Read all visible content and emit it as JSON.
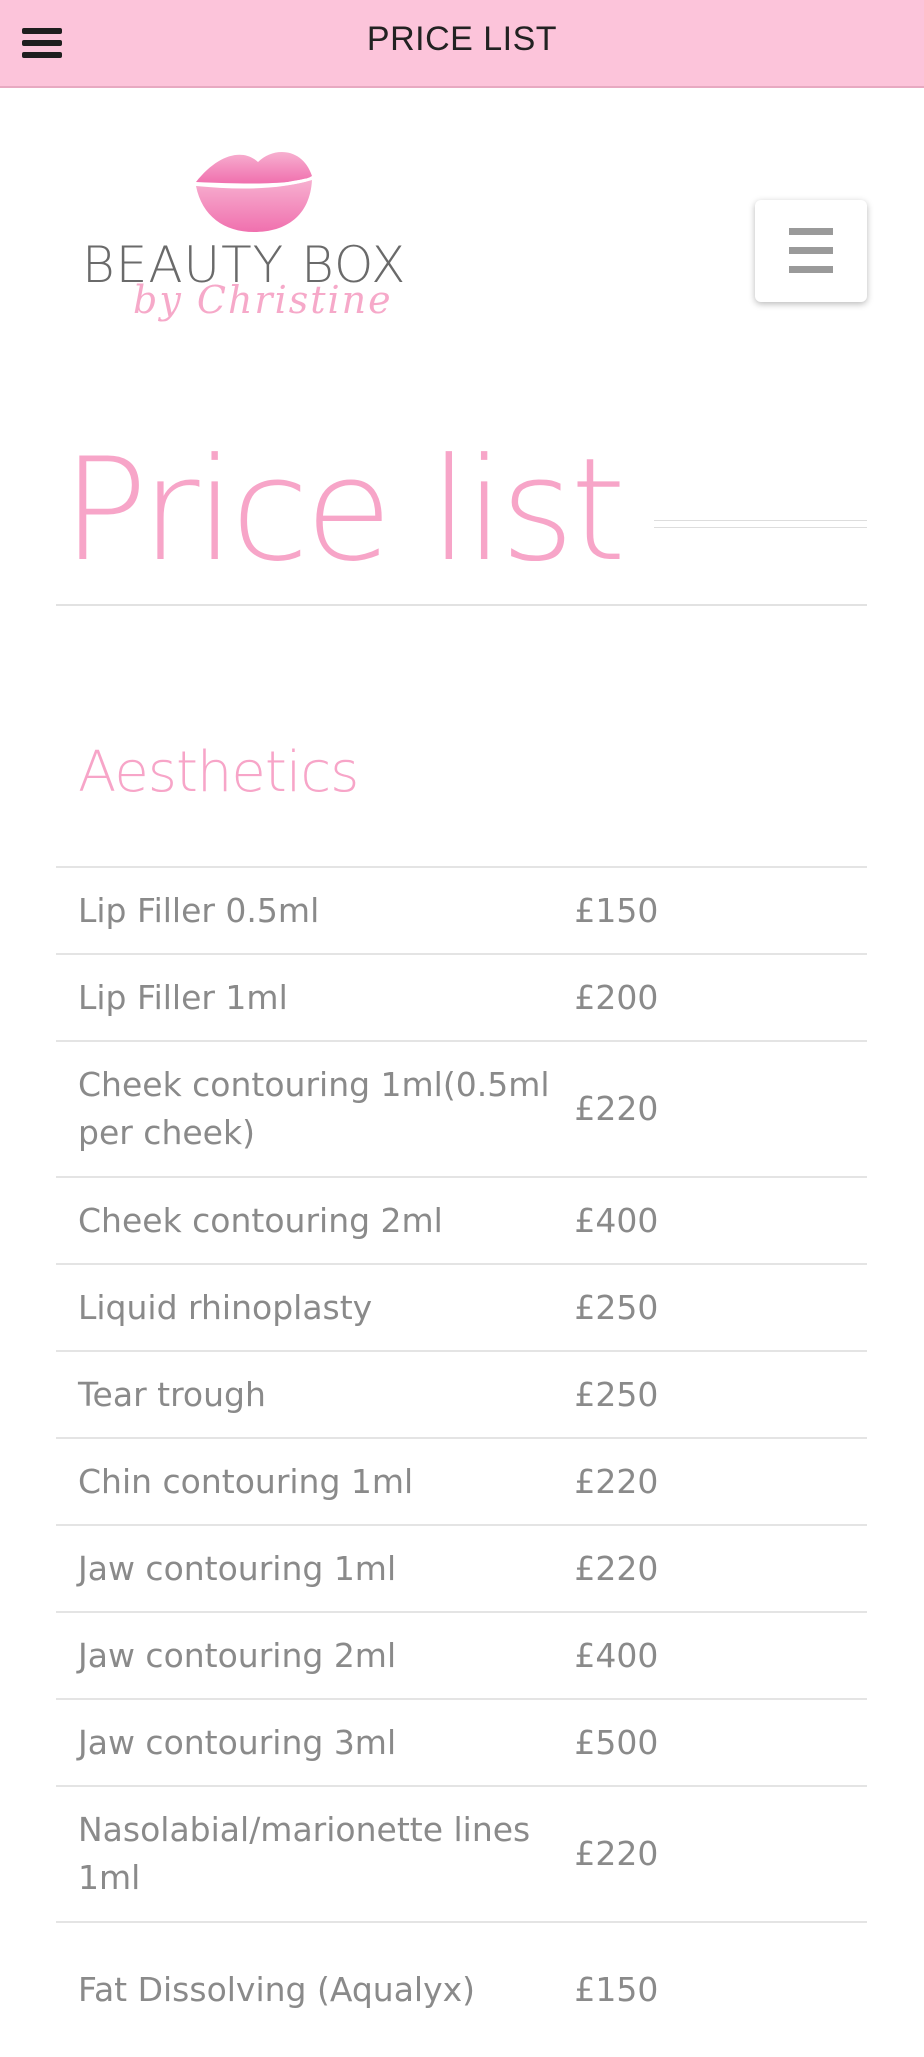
{
  "header": {
    "title": "PRICE LIST"
  },
  "logo": {
    "brand": "BEAUTY BOX",
    "tagline": "by Christine"
  },
  "page": {
    "title": "Price list"
  },
  "section": {
    "heading": "Aesthetics"
  },
  "price_list": [
    {
      "name": "Lip Filler 0.5ml",
      "price": "£150"
    },
    {
      "name": "Lip Filler 1ml",
      "price": "£200"
    },
    {
      "name": "Cheek contouring 1ml(0.5ml per cheek)",
      "price": "£220"
    },
    {
      "name": "Cheek contouring 2ml",
      "price": "£400"
    },
    {
      "name": "Liquid rhinoplasty",
      "price": "£250"
    },
    {
      "name": "Tear trough",
      "price": "£250"
    },
    {
      "name": "Chin contouring 1ml",
      "price": "£220"
    },
    {
      "name": "Jaw contouring 1ml",
      "price": "£220"
    },
    {
      "name": "Jaw contouring 2ml",
      "price": "£400"
    },
    {
      "name": "Jaw contouring 3ml",
      "price": "£500"
    },
    {
      "name": "Nasolabial/marionette lines 1ml",
      "price": "£220"
    },
    {
      "name": "Fat Dissolving (Aqualyx)",
      "price": "£150"
    }
  ],
  "colors": {
    "header_bg": "#fcc4da",
    "accent_pink": "#f7a5c8",
    "body_text": "#8a8a8a"
  },
  "icons": {
    "top_menu": "hamburger-icon",
    "site_menu": "hamburger-icon",
    "logo_mark": "lips-icon"
  }
}
